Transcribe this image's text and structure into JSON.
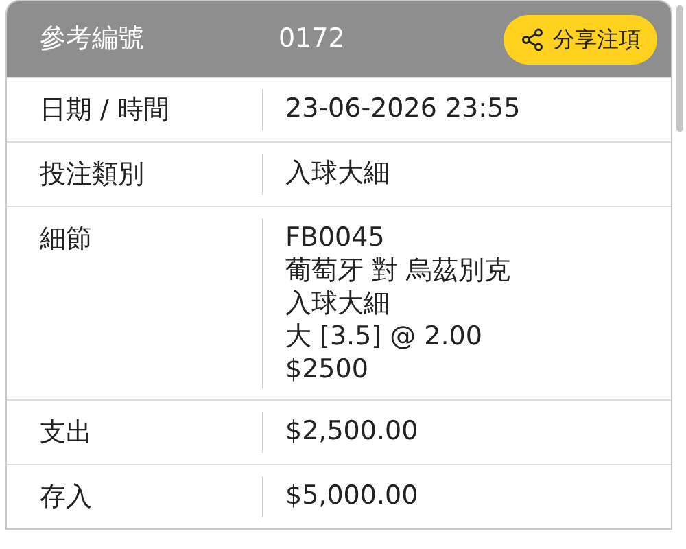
{
  "header": {
    "label": "參考編號",
    "value": "0172",
    "share_button": "分享注項"
  },
  "rows": [
    {
      "label": "日期 / 時間",
      "lines": [
        "23-06-2026 23:55"
      ]
    },
    {
      "label": "投注類別",
      "lines": [
        "入球大細"
      ]
    },
    {
      "label": "細節",
      "lines": [
        "FB0045",
        "葡萄牙 對 烏茲別克",
        "入球大細",
        "大 [3.5] @ 2.00",
        "$2500"
      ]
    },
    {
      "label": "支出",
      "lines": [
        "$2,500.00"
      ]
    },
    {
      "label": "存入",
      "lines": [
        "$5,000.00"
      ]
    }
  ]
}
